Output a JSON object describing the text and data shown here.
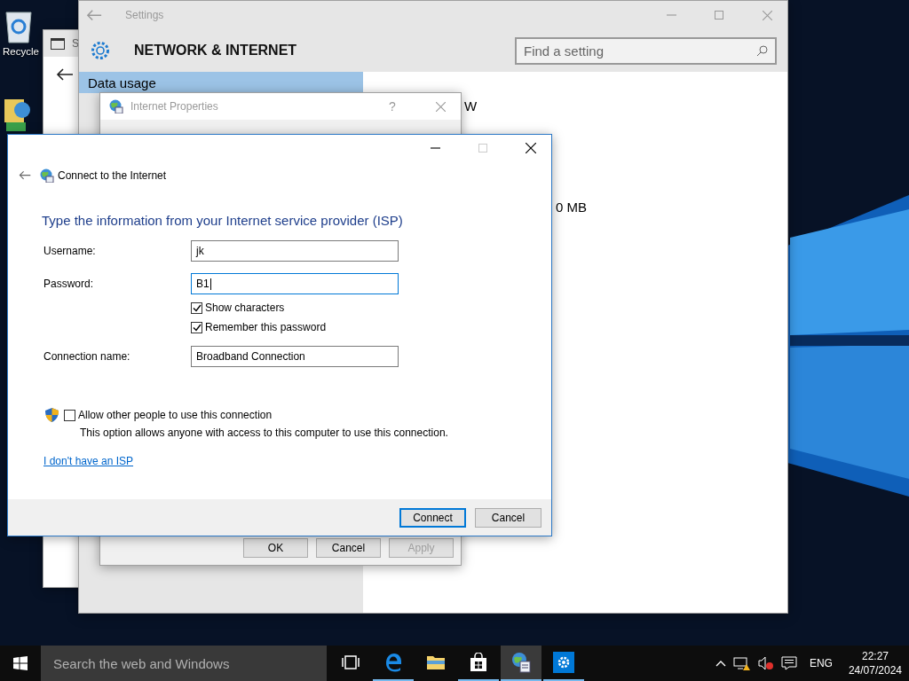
{
  "desktop": {
    "icons": [
      {
        "kind": "recycle-bin",
        "label": "Recycle"
      },
      {
        "kind": "folder-globe"
      }
    ]
  },
  "background_window": {
    "title": "S"
  },
  "settings": {
    "title": "Settings",
    "header": "NETWORK & INTERNET",
    "search": {
      "placeholder": "Find a setting"
    },
    "nav": [
      {
        "label": "Data usage",
        "selected": true
      }
    ],
    "content": [
      "W",
      "0 MB"
    ]
  },
  "internet_properties": {
    "title": "Internet Properties",
    "help_button": "?",
    "buttons": [
      {
        "label": "OK",
        "disabled": false
      },
      {
        "label": "Cancel",
        "disabled": false
      },
      {
        "label": "Apply",
        "disabled": true
      }
    ]
  },
  "connect_dialog": {
    "title": "Connect to the Internet",
    "heading": "Type the information from your Internet service provider (ISP)",
    "fields": [
      {
        "label": "Username:",
        "value": "jk",
        "focused": false
      },
      {
        "label": "Password:",
        "value": "B1",
        "focused": true
      }
    ],
    "options": [
      {
        "label": "Show characters",
        "checked": true
      },
      {
        "label": "Remember this password",
        "checked": true
      }
    ],
    "connection_name": {
      "label": "Connection name:",
      "value": "Broadband Connection",
      "focused": false
    },
    "share": {
      "label": "Allow other people to use this connection",
      "checked": false,
      "description": "This option allows anyone with access to this computer to use this connection."
    },
    "link": "I don't have an ISP",
    "buttons": [
      {
        "label": "Connect",
        "default": true
      },
      {
        "label": "Cancel",
        "default": false
      }
    ]
  },
  "taskbar": {
    "search": {
      "placeholder": "Search the web and Windows"
    },
    "apps": [
      {
        "kind": "task-view",
        "running": false,
        "active": false
      },
      {
        "kind": "edge",
        "running": true,
        "active": false
      },
      {
        "kind": "explorer",
        "running": false,
        "active": false
      },
      {
        "kind": "store",
        "running": true,
        "active": false
      },
      {
        "kind": "internet-properties",
        "running": true,
        "active": true
      },
      {
        "kind": "settings",
        "running": true,
        "active": false
      }
    ],
    "language": "ENG",
    "time": "22:27",
    "date": "24/07/2024"
  }
}
